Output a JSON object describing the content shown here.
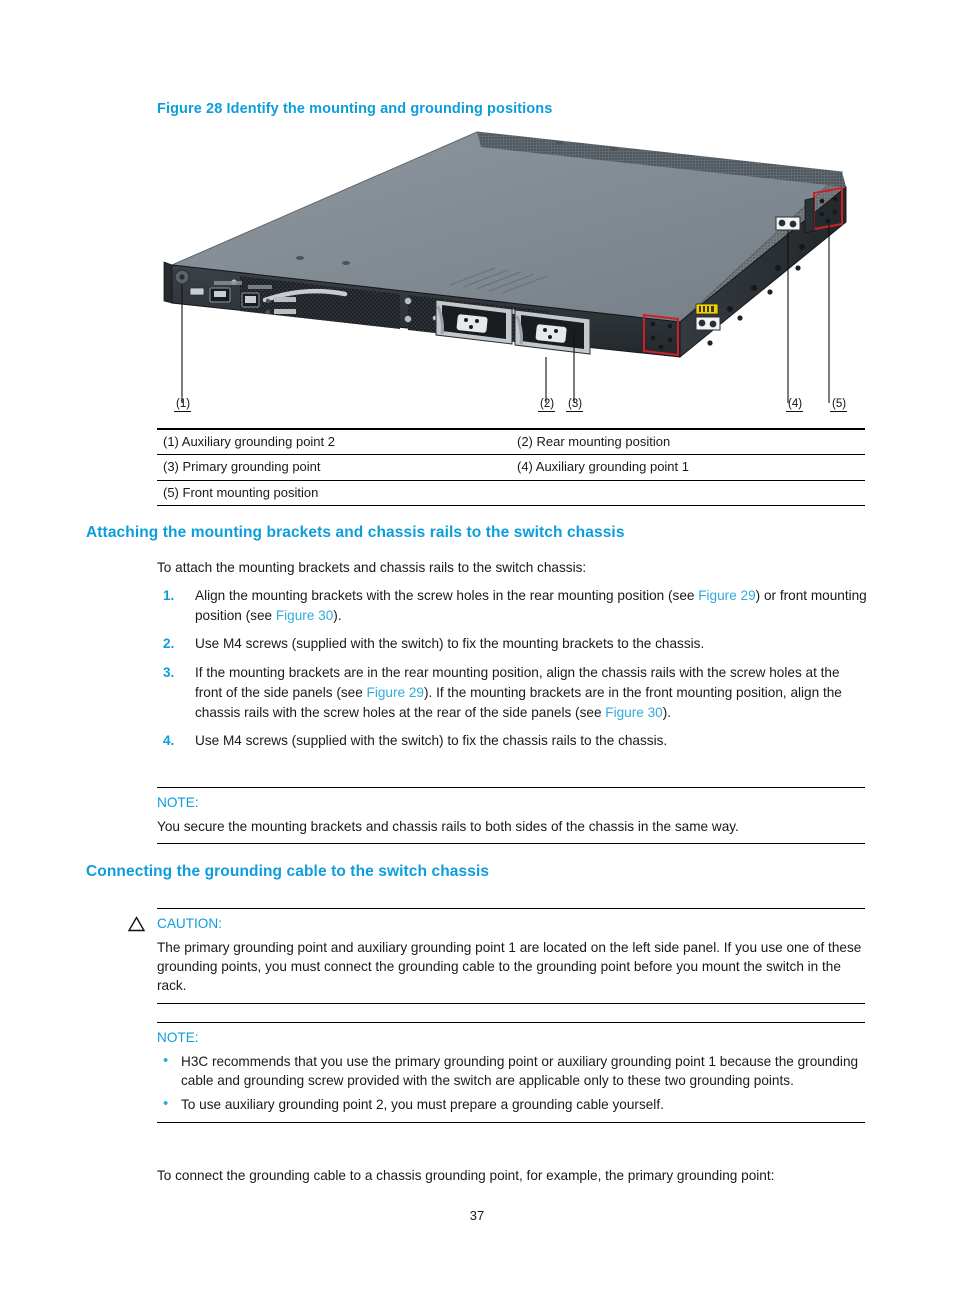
{
  "figure": {
    "caption": "Figure 28 Identify the mounting and grounding positions",
    "callouts": [
      {
        "id": "c1",
        "label": "(1)"
      },
      {
        "id": "c2",
        "label": "(2)"
      },
      {
        "id": "c3",
        "label": "(3)"
      },
      {
        "id": "c4",
        "label": "(4)"
      },
      {
        "id": "c5",
        "label": "(5)"
      }
    ],
    "legend": [
      {
        "left": "(1) Auxiliary grounding point 2",
        "right": "(2) Rear mounting position"
      },
      {
        "left": "(3) Primary grounding point",
        "right": "(4) Auxiliary grounding point 1"
      },
      {
        "left": "(5) Front mounting position",
        "right": ""
      }
    ]
  },
  "section_brackets": {
    "heading": "Attaching the mounting brackets and chassis rails to the switch chassis",
    "intro": "To attach the mounting brackets and chassis rails to the switch chassis:",
    "steps": [
      {
        "num": "1.",
        "parts": [
          {
            "t": "Align the mounting brackets with the screw holes in the rear mounting position (see ",
            "link": false
          },
          {
            "t": "Figure 29",
            "link": true
          },
          {
            "t": ") or front mounting position (see ",
            "link": false
          },
          {
            "t": "Figure 30",
            "link": true
          },
          {
            "t": ").",
            "link": false
          }
        ]
      },
      {
        "num": "2.",
        "parts": [
          {
            "t": "Use M4 screws (supplied with the switch) to fix the mounting brackets to the chassis.",
            "link": false
          }
        ]
      },
      {
        "num": "3.",
        "parts": [
          {
            "t": "If the mounting brackets are in the rear mounting position, align the chassis rails with the screw holes at the front of the side panels (see ",
            "link": false
          },
          {
            "t": "Figure 29",
            "link": true
          },
          {
            "t": "). If the mounting brackets are in the front mounting position, align the chassis rails with the screw holes at the rear of the side panels (see ",
            "link": false
          },
          {
            "t": "Figure 30",
            "link": true
          },
          {
            "t": ").",
            "link": false
          }
        ]
      },
      {
        "num": "4.",
        "parts": [
          {
            "t": "Use M4 screws (supplied with the switch) to fix the chassis rails to the chassis.",
            "link": false
          }
        ]
      }
    ],
    "note": {
      "title": "NOTE:",
      "body": "You secure the mounting brackets and chassis rails to both sides of the chassis in the same way."
    }
  },
  "section_grounding": {
    "heading": "Connecting the grounding cable to the switch chassis",
    "caution": {
      "title": "CAUTION:",
      "body": "The primary grounding point and auxiliary grounding point 1 are located on the left side panel. If you use one of these grounding points, you must connect the grounding cable to the grounding point before you mount the switch in the rack."
    },
    "note": {
      "title": "NOTE:",
      "bullets": [
        "H3C recommends that you use the primary grounding point or auxiliary grounding point 1 because the grounding cable and grounding screw provided with the switch are applicable only to these two grounding points.",
        "To use auxiliary grounding point 2, you must prepare a grounding cable yourself."
      ]
    },
    "closing": "To connect the grounding cable to a chassis grounding point, for example, the primary grounding point:"
  },
  "footer": {
    "page_number": "37"
  },
  "colors": {
    "accent_blue": "#0d9ddb",
    "link_blue": "#33aade",
    "highlight_red": "#cc2027",
    "chassis_top": "#808a91",
    "chassis_front": "#2e3338",
    "label_yellow": "#f4d000"
  }
}
